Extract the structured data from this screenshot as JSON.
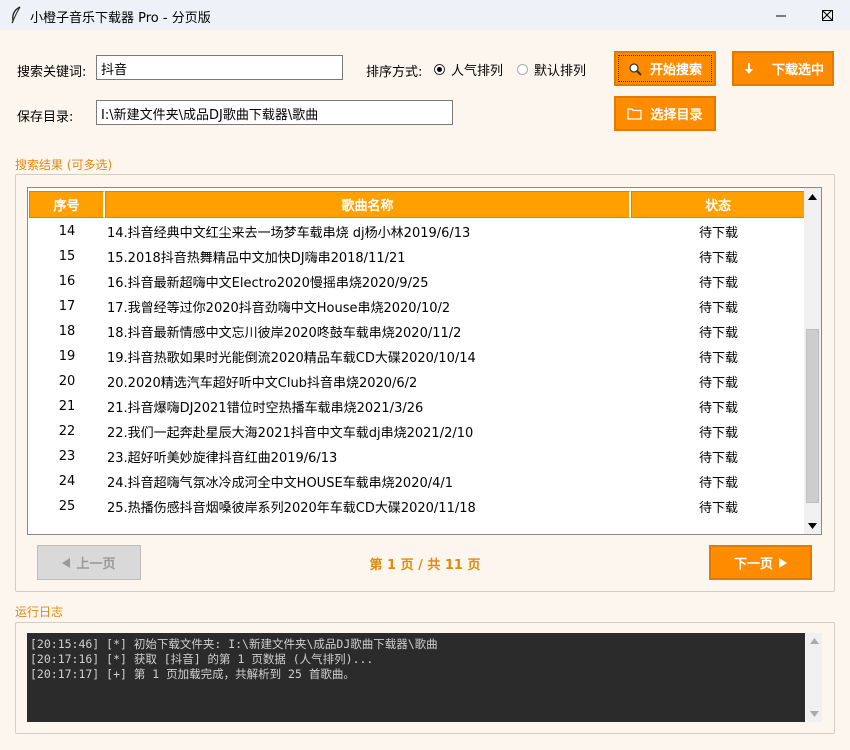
{
  "window": {
    "title": "小橙子音乐下载器 Pro - 分页版",
    "minimize_icon": "minimize-icon",
    "maximize_icon": "maximize-icon",
    "close_icon": "close-icon"
  },
  "search": {
    "keyword_label": "搜索关键词:",
    "keyword_value": "抖音",
    "sort_label": "排序方式:",
    "sort_options": [
      {
        "label": "人气排列",
        "selected": true
      },
      {
        "label": "默认排列",
        "selected": false
      }
    ],
    "search_button": "开始搜索",
    "download_button": "下载选中",
    "save_dir_label": "保存目录:",
    "save_dir_value": "I:\\新建文件夹\\成品DJ歌曲下载器\\歌曲",
    "choose_dir_button": "选择目录"
  },
  "results": {
    "group_title": "搜索结果 (可多选)",
    "columns": [
      "序号",
      "歌曲名称",
      "状态"
    ],
    "rows": [
      {
        "no": "14",
        "name": "14.抖音经典中文红尘来去一场梦车载串烧 dj杨小林2019/6/13",
        "status": "待下载"
      },
      {
        "no": "15",
        "name": "15.2018抖音热舞精品中文加快DJ嗨串2018/11/21",
        "status": "待下载"
      },
      {
        "no": "16",
        "name": "16.抖音最新超嗨中文Electro2020慢摇串烧2020/9/25",
        "status": "待下载"
      },
      {
        "no": "17",
        "name": "17.我曾经等过你2020抖音劲嗨中文House串烧2020/10/2",
        "status": "待下载"
      },
      {
        "no": "18",
        "name": "18.抖音最新情感中文忘川彼岸2020咚鼓车载串烧2020/11/2",
        "status": "待下载"
      },
      {
        "no": "19",
        "name": "19.抖音热歌如果时光能倒流2020精品车载CD大碟2020/10/14",
        "status": "待下载"
      },
      {
        "no": "20",
        "name": "20.2020精选汽车超好听中文Club抖音串烧2020/6/2",
        "status": "待下载"
      },
      {
        "no": "21",
        "name": "21.抖音爆嗨DJ2021错位时空热播车载串烧2021/3/26",
        "status": "待下载"
      },
      {
        "no": "22",
        "name": "22.我们一起奔赴星辰大海2021抖音中文车载dj串烧2021/2/10",
        "status": "待下载"
      },
      {
        "no": "23",
        "name": "23.超好听美妙旋律抖音红曲2019/6/13",
        "status": "待下载"
      },
      {
        "no": "24",
        "name": "24.抖音超嗨气氛冰冷成河全中文HOUSE车载串烧2020/4/1",
        "status": "待下载"
      },
      {
        "no": "25",
        "name": "25.热播伤感抖音烟嗓彼岸系列2020年车载CD大碟2020/11/18",
        "status": "待下载"
      }
    ],
    "scroll_fraction": 0.9
  },
  "pagination": {
    "prev_label": "上一页",
    "page_info": "第 1 页 / 共 11 页",
    "next_label": "下一页"
  },
  "log": {
    "group_title": "运行日志",
    "lines": [
      "[20:15:46] [*] 初始下载文件夹: I:\\新建文件夹\\成品DJ歌曲下载器\\歌曲",
      "[20:17:16] [*] 获取 [抖音] 的第 1 页数据 (人气排列)...",
      "[20:17:17] [+] 第 1 页加载完成，共解析到 25 首歌曲。"
    ]
  },
  "colors": {
    "accent": "#ff8c00",
    "header": "#ffa000",
    "group_title": "#e08a10",
    "log_bg": "#2b2b2b"
  }
}
